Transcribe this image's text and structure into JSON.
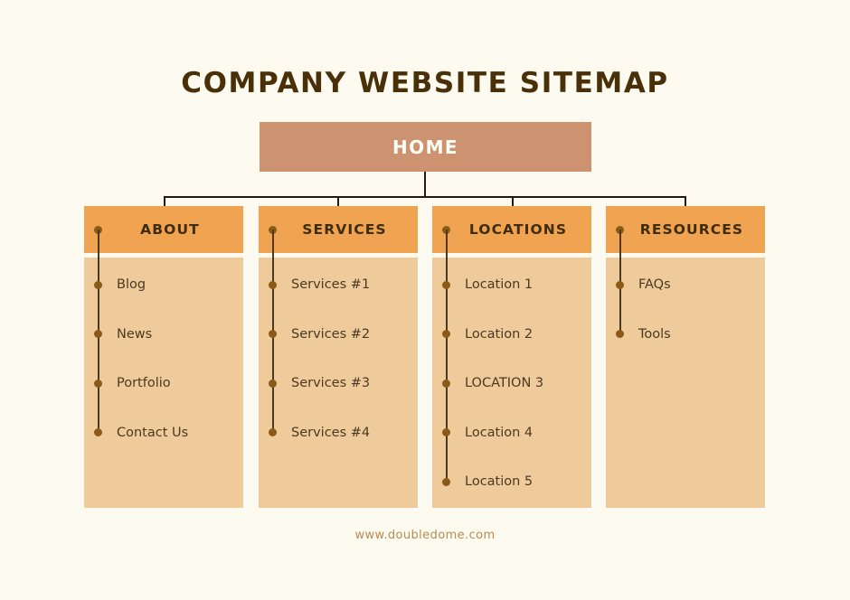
{
  "page": {
    "title": "COMPANY WEBSITE SITEMAP",
    "background_color": "#FDFAF0",
    "title_color": "#493008",
    "footer_url": "www.doubledome.com",
    "footer_color": "#B98A52"
  },
  "root": {
    "label": "HOME",
    "box_color": "#CD9370",
    "text_color": "#FFFDF6"
  },
  "style": {
    "header_color": "#F0A350",
    "header_text_color": "#3E2C0C",
    "body_color": "#EFCB9B",
    "item_text_color": "#4A3A22",
    "dot_color": "#8A5A16",
    "connector_color": "#201A12"
  },
  "chart_data": {
    "type": "diagram",
    "title": "COMPANY WEBSITE SITEMAP",
    "root": "HOME",
    "branches": [
      {
        "name": "ABOUT",
        "children": [
          "Blog",
          "News",
          "Portfolio",
          "Contact Us"
        ]
      },
      {
        "name": "SERVICES",
        "children": [
          "Services #1",
          "Services #2",
          "Services #3",
          "Services #4"
        ]
      },
      {
        "name": "LOCATIONS",
        "children": [
          "Location 1",
          "Location 2",
          "LOCATION 3",
          "Location 4",
          "Location 5"
        ]
      },
      {
        "name": "RESOURCES",
        "children": [
          "FAQs",
          "Tools"
        ]
      }
    ]
  },
  "columns": [
    {
      "header": "ABOUT",
      "items": [
        {
          "label": "Blog"
        },
        {
          "label": "News"
        },
        {
          "label": "Portfolio"
        },
        {
          "label": "Contact Us"
        }
      ]
    },
    {
      "header": "SERVICES",
      "items": [
        {
          "label": "Services #1"
        },
        {
          "label": "Services #2"
        },
        {
          "label": "Services #3"
        },
        {
          "label": "Services #4"
        }
      ]
    },
    {
      "header": "LOCATIONS",
      "items": [
        {
          "label": "Location 1"
        },
        {
          "label": "Location 2"
        },
        {
          "label": "LOCATION 3"
        },
        {
          "label": "Location 4"
        },
        {
          "label": "Location 5"
        }
      ]
    },
    {
      "header": "RESOURCES",
      "items": [
        {
          "label": "FAQs"
        },
        {
          "label": "Tools"
        }
      ]
    }
  ]
}
